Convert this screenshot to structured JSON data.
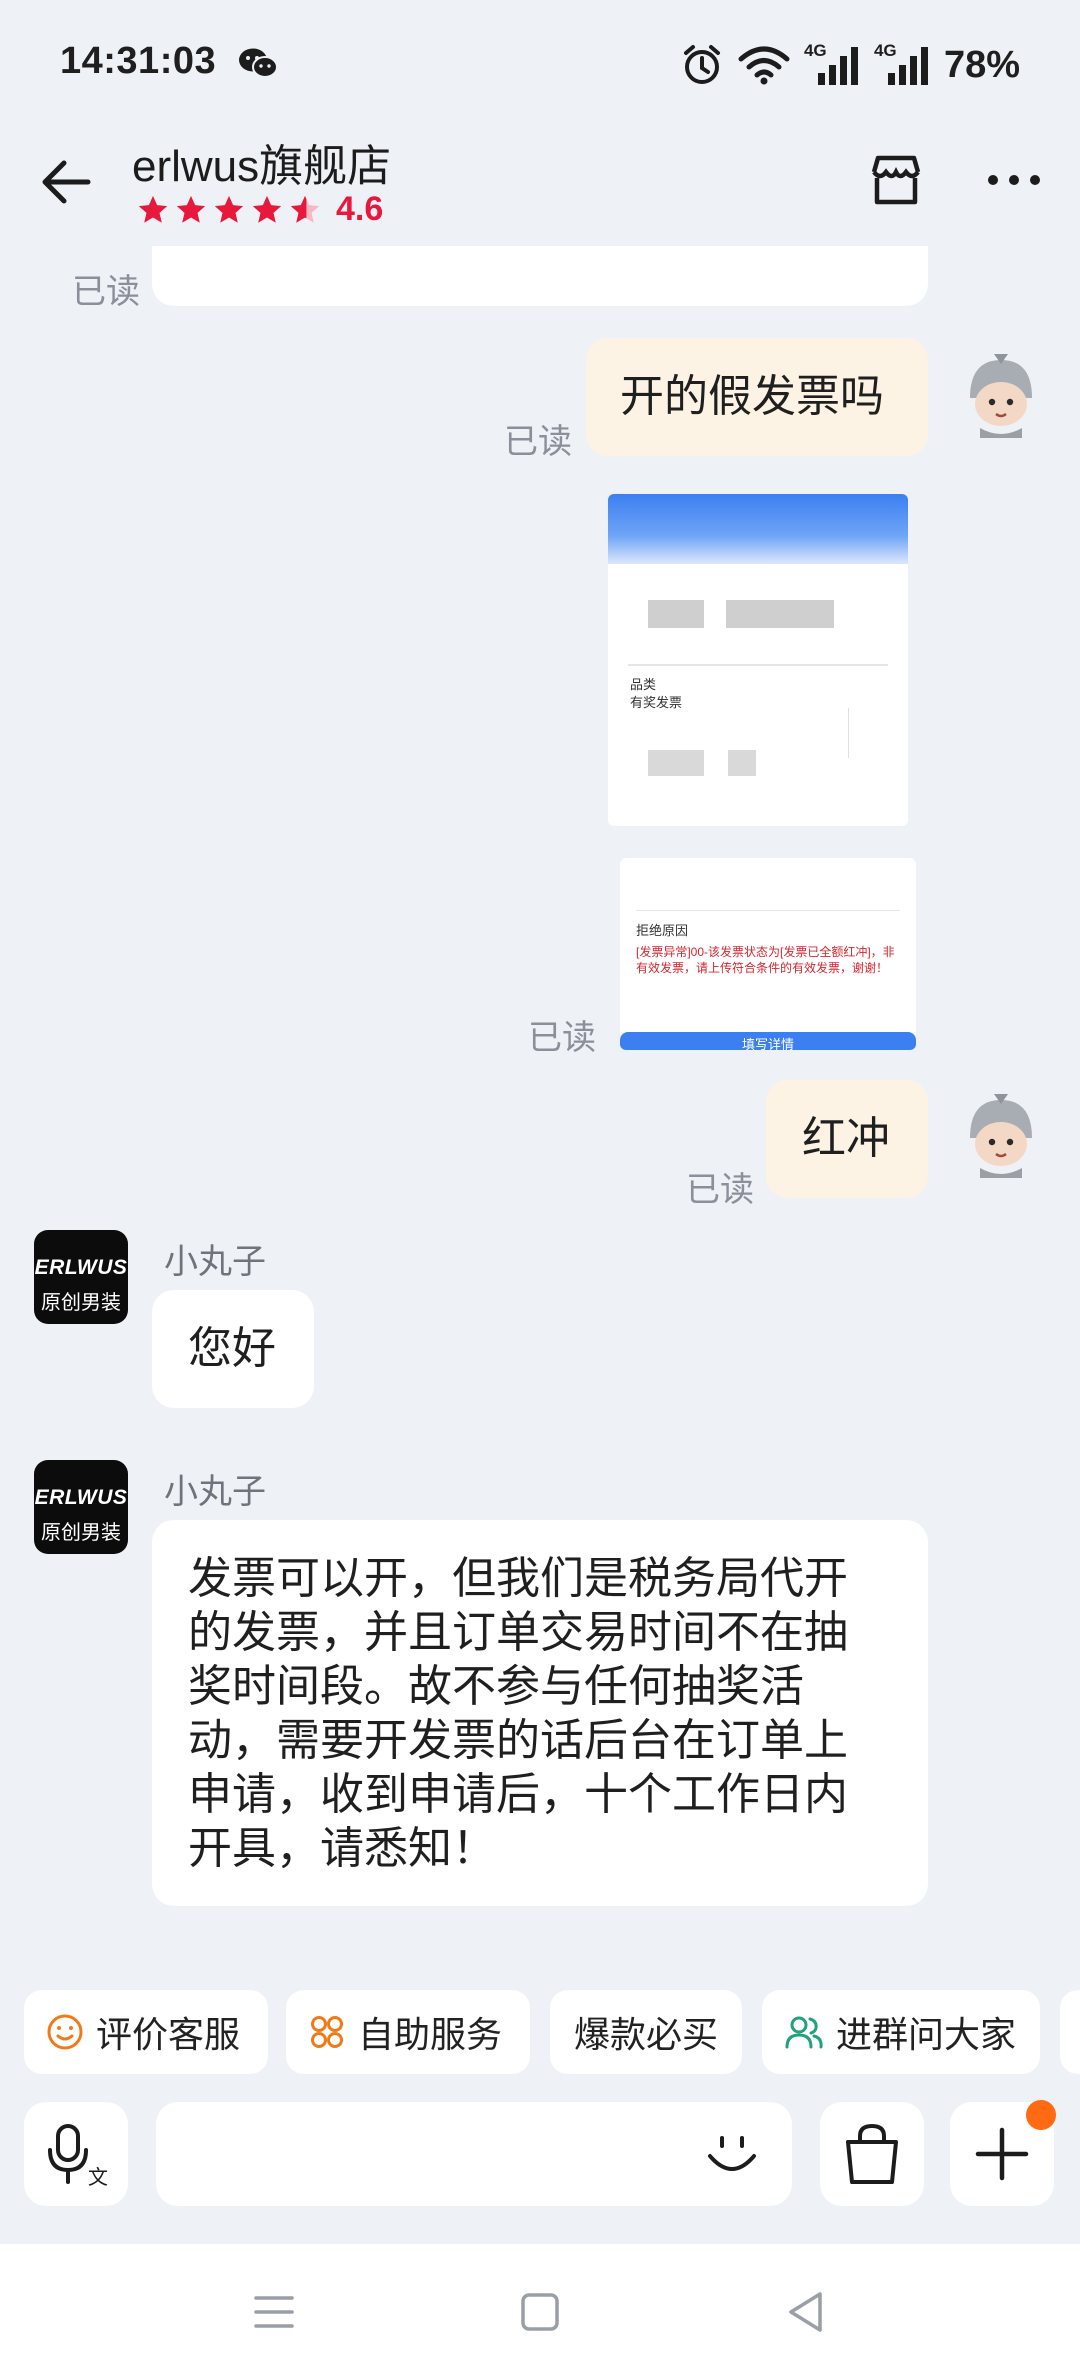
{
  "status_bar": {
    "time": "14:31:03",
    "battery": "78%",
    "network1": "4G",
    "network2": "4G"
  },
  "header": {
    "shop_name": "erlwus旗舰店",
    "rating": "4.6"
  },
  "messages": [
    {
      "id": "m1",
      "read": "已读"
    },
    {
      "id": "m2",
      "text": "开的假发票吗",
      "read": "已读"
    },
    {
      "id": "m3",
      "read": "已读",
      "image1": {
        "section_label": "品类",
        "field": "有奖发票"
      },
      "image2": {
        "title": "拒绝原因",
        "reason": "[发票异常]00-该发票状态为[发票已全额红冲]，非有效发票，请上传符合条件的有效发票，谢谢！",
        "button": "填写详情"
      }
    },
    {
      "id": "m4",
      "text": "红冲",
      "read": "已读"
    },
    {
      "id": "m5",
      "sender": "小丸子",
      "text": "您好"
    },
    {
      "id": "m6",
      "sender": "小丸子",
      "lines": [
        "发票可以开，但我们是税务局代开",
        "的发票，并且订单交易时间不在抽",
        "奖时间段。故不参与任何抽奖活",
        "动，需要开发票的话后台在订单上",
        "申请，收到申请后，十个工作日内",
        "开具，请悉知！"
      ]
    }
  ],
  "shop_avatar": {
    "line1": "ERLWUS",
    "line2": "原创男装"
  },
  "quick_actions": [
    "评价客服",
    "自助服务",
    "爆款必买",
    "进群问大家"
  ],
  "colors": {
    "accent_red": "#E8183C",
    "bubble_mine": "#FCF3E4",
    "bg": "#EEF1F6",
    "badge": "#FF6A13"
  }
}
